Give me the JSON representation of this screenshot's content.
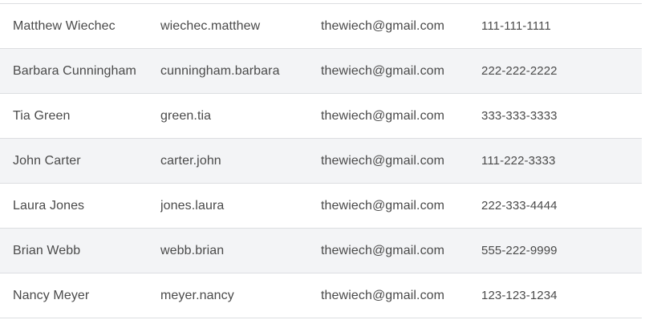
{
  "rows": [
    {
      "name": "Matthew Wiechec",
      "username": "wiechec.matthew",
      "email": "thewiech@gmail.com",
      "phone": "111-111-1111"
    },
    {
      "name": "Barbara Cunningham",
      "username": "cunningham.barbara",
      "email": "thewiech@gmail.com",
      "phone": "222-222-2222"
    },
    {
      "name": "Tia Green",
      "username": "green.tia",
      "email": "thewiech@gmail.com",
      "phone": "333-333-3333"
    },
    {
      "name": "John Carter",
      "username": "carter.john",
      "email": "thewiech@gmail.com",
      "phone": "111-222-3333"
    },
    {
      "name": "Laura Jones",
      "username": "jones.laura",
      "email": "thewiech@gmail.com",
      "phone": "222-333-4444"
    },
    {
      "name": "Brian Webb",
      "username": "webb.brian",
      "email": "thewiech@gmail.com",
      "phone": "555-222-9999"
    },
    {
      "name": "Nancy Meyer",
      "username": "meyer.nancy",
      "email": "thewiech@gmail.com",
      "phone": "123-123-1234"
    }
  ],
  "colors": {
    "text": "#4a4a4a",
    "row_alt_bg": "#f3f4f6",
    "row_border": "#dcdee1"
  }
}
